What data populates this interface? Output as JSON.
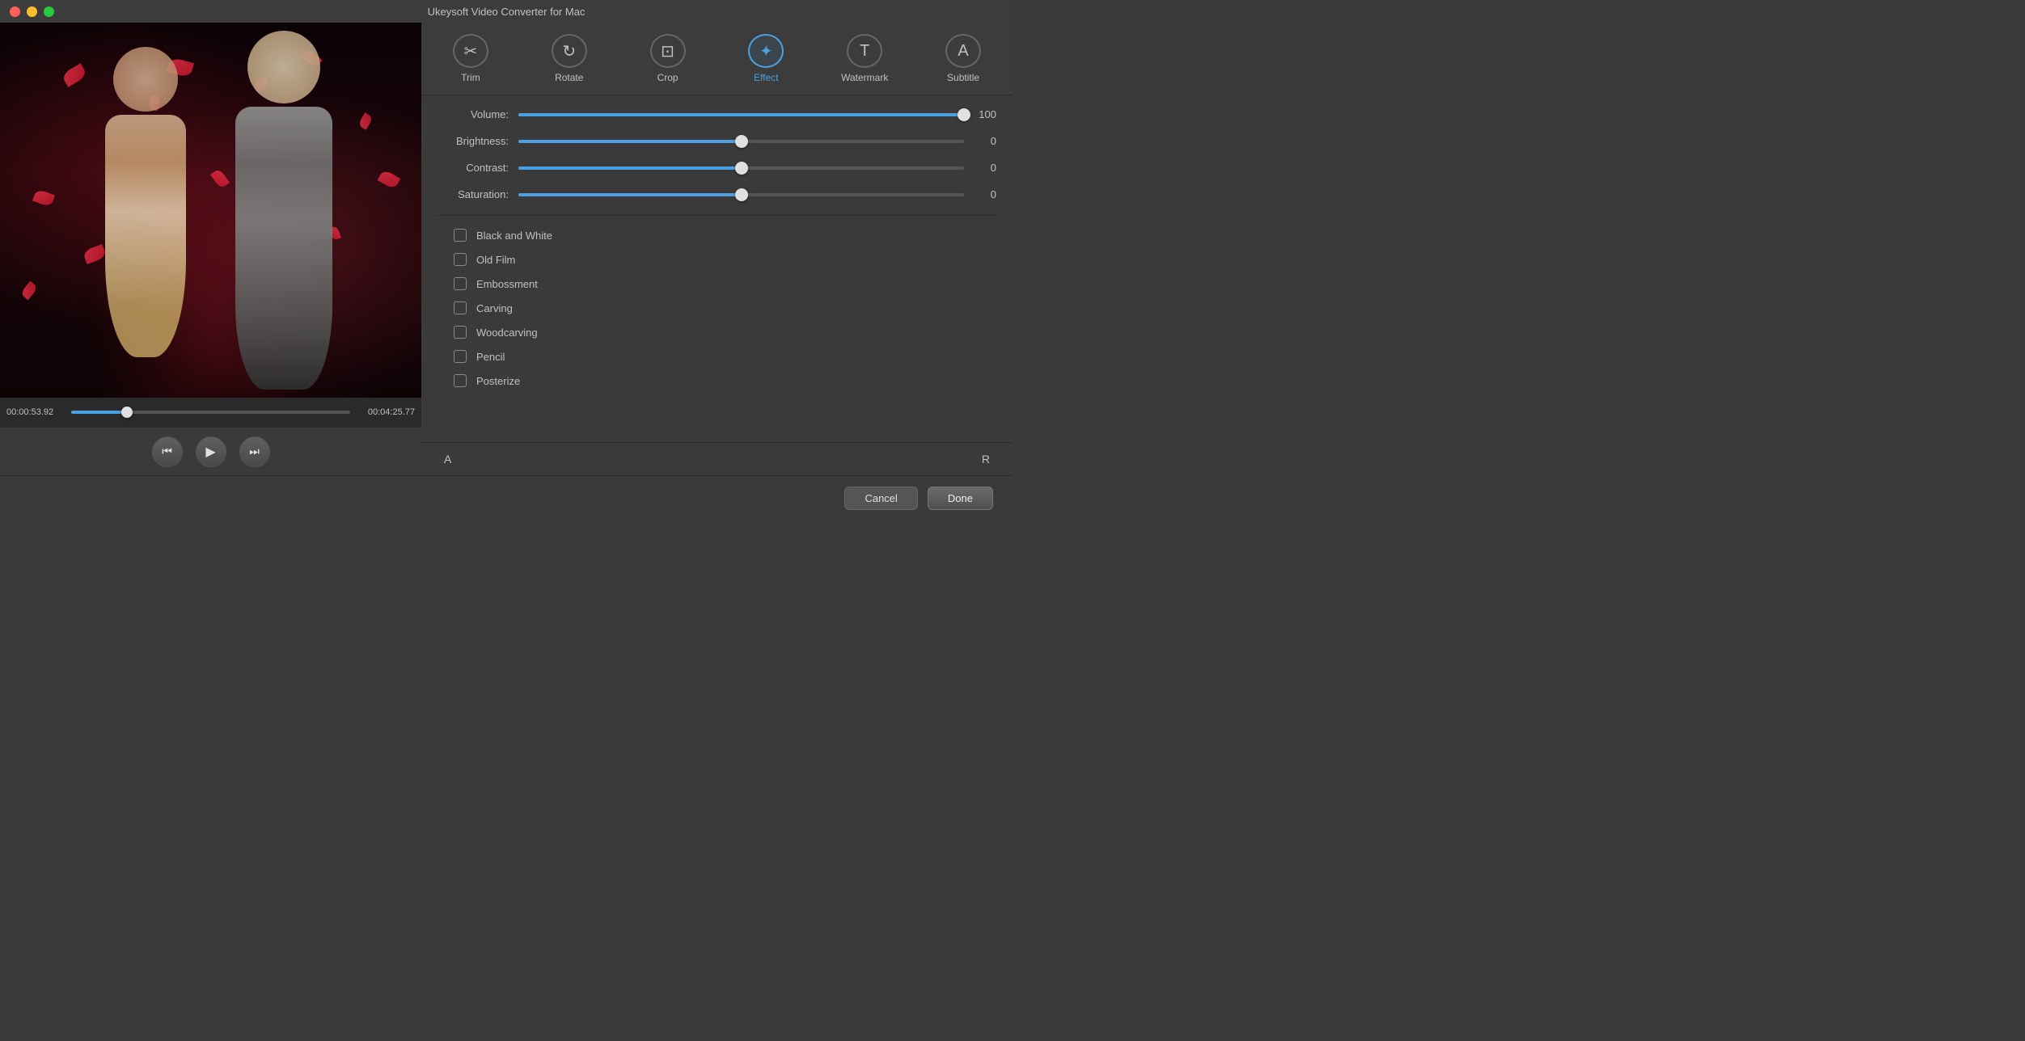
{
  "app": {
    "title": "Ukeysoft Video Converter for Mac"
  },
  "toolbar": {
    "items": [
      {
        "id": "trim",
        "label": "Trim",
        "icon": "✂",
        "active": false
      },
      {
        "id": "rotate",
        "label": "Rotate",
        "icon": "↻",
        "active": false
      },
      {
        "id": "crop",
        "label": "Crop",
        "icon": "⊡",
        "active": false
      },
      {
        "id": "effect",
        "label": "Effect",
        "icon": "✦",
        "active": true
      },
      {
        "id": "watermark",
        "label": "Watermark",
        "icon": "T",
        "active": false
      },
      {
        "id": "subtitle",
        "label": "Subtitle",
        "icon": "A",
        "active": false
      }
    ]
  },
  "sliders": [
    {
      "id": "volume",
      "label": "Volume:",
      "value": 100,
      "percent": 100
    },
    {
      "id": "brightness",
      "label": "Brightness:",
      "value": 0,
      "percent": 50
    },
    {
      "id": "contrast",
      "label": "Contrast:",
      "value": 0,
      "percent": 50
    },
    {
      "id": "saturation",
      "label": "Saturation:",
      "value": 0,
      "percent": 50
    }
  ],
  "effects": [
    {
      "id": "black-white",
      "label": "Black and White",
      "checked": false
    },
    {
      "id": "old-film",
      "label": "Old Film",
      "checked": false
    },
    {
      "id": "embossment",
      "label": "Embossment",
      "checked": false
    },
    {
      "id": "carving",
      "label": "Carving",
      "checked": false
    },
    {
      "id": "woodcarving",
      "label": "Woodcarving",
      "checked": false
    },
    {
      "id": "pencil",
      "label": "Pencil",
      "checked": false
    },
    {
      "id": "posterize",
      "label": "Posterize",
      "checked": false
    }
  ],
  "ar_buttons": {
    "left": "A",
    "right": "R"
  },
  "timeline": {
    "current": "00:00:53.92",
    "total": "00:04:25.77",
    "progress_percent": 20
  },
  "bottom_buttons": {
    "cancel": "Cancel",
    "done": "Done"
  },
  "colors": {
    "accent": "#4aa0e0",
    "panel_bg": "#3a3a3a",
    "toolbar_bg": "#3c3c3c",
    "text_primary": "#e0e0e0",
    "text_secondary": "#c0c0c0"
  }
}
